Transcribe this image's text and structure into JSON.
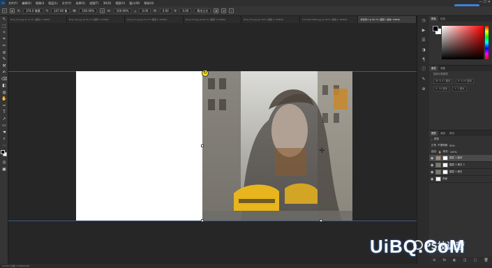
{
  "menubar": {
    "items": [
      "文件(F)",
      "编辑(E)",
      "图像(I)",
      "图层(L)",
      "文字(Y)",
      "选择(S)",
      "滤镜(T)",
      "3D(D)",
      "视图(V)",
      "窗口(W)",
      "帮助(H)"
    ],
    "cloud_button": "正版授权",
    "window_controls": "— ☐ ✕"
  },
  "optionsbar": {
    "x_label": "X:",
    "x_value": "374.0 像素",
    "y_label": "Y:",
    "y_value": "247.00 像",
    "w_label": "W:",
    "w_value": "100.00%",
    "h_label": "H:",
    "h_value": "100.00%",
    "angle_label": "△",
    "angle_value": "0.00",
    "h_skew_label": "H:",
    "h_skew_value": "0.00",
    "v_skew_label": "V:",
    "v_skew_value": "0.00",
    "interp": "两次立方"
  },
  "tabs": [
    {
      "label": "8mg (72).jpg @ 72.7% (图层 0, RGB/8...",
      "active": false
    },
    {
      "label": "8mg (25).jpg @ 66.7% (图层 0, RGB/8)",
      "active": false
    },
    {
      "label": "8mg (71).jpg @ 72.7% (图层 0, RGB/8)",
      "active": false
    },
    {
      "label": "8mg (73).jpg @ 66.7% (图层 0, RGB/8)",
      "active": false
    },
    {
      "label": "8mg (75).jpg @ 100% (图层 0, RGB/8)",
      "active": false
    },
    {
      "label": "1511005-4866.jpg @ 100% (图层 0, RGB/8)",
      "active": false
    },
    {
      "label": "未标题-1 @ 66.7% (图层 1 副本, RGB/8)",
      "active": true
    }
  ],
  "tools": [
    "↖",
    "⬚",
    "✧",
    "⌗",
    "✂",
    "⊘",
    "✎",
    "⚒",
    "✍",
    "⌫",
    "◧",
    "◍",
    "✋",
    "✑",
    "T",
    "↗",
    "▭",
    "☚",
    "⌕",
    "⋯"
  ],
  "status": "33.31%   文档:1.72M/16.4M",
  "right_panels": {
    "color_tabs": [
      "颜色",
      "色板"
    ],
    "props_tabs": [
      "属性",
      "调整"
    ],
    "props_title": "智能对象图层",
    "props_rows": [
      [
        "W: 8.47 厘米",
        "H: 6.93 厘米"
      ],
      [
        "X: 10 厘米",
        "Y: 3 厘米"
      ]
    ],
    "layers_tabs": [
      "图层",
      "通道",
      "路径"
    ],
    "kind_label": "类型",
    "blend_mode": "正常",
    "opacity_label": "不透明度:",
    "opacity_value": "80%",
    "lock_label": "锁定:",
    "fill_label": "填充:",
    "fill_value": "100%",
    "layers": [
      {
        "name": "图层 1 副本",
        "selected": true
      },
      {
        "name": "图层 1 拷贝 2",
        "selected": false
      },
      {
        "name": "图层 1 拷贝",
        "selected": false
      },
      {
        "name": "背景",
        "selected": false
      }
    ],
    "footer_icons": [
      "⊖",
      "fx",
      "◐",
      "◫",
      "▢",
      "🗑"
    ]
  },
  "watermark": {
    "main": "UiBQ.CoM",
    "sub": "PS技训营"
  },
  "colors": {
    "rotation_handle": "#f2e01a",
    "guide": "#3c5a80",
    "cloud_button": "#3b80e0"
  }
}
